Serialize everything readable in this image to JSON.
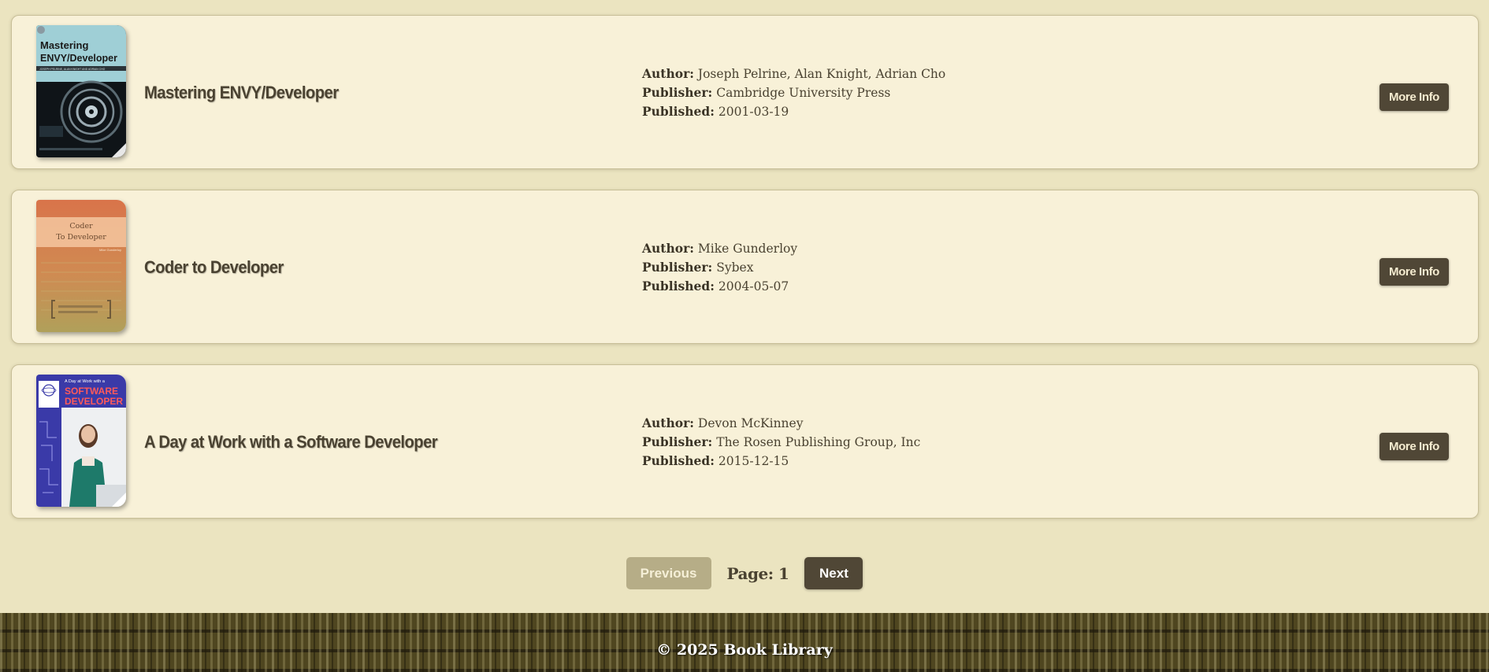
{
  "books": [
    {
      "title": "Mastering ENVY/Developer",
      "author_label": "Author:",
      "author": "Joseph Pelrine, Alan Knight, Adrian Cho",
      "publisher_label": "Publisher:",
      "publisher": "Cambridge University Press",
      "published_label": "Published:",
      "published": "2001-03-19",
      "button": "More Info",
      "cover": {
        "title_line1": "Mastering",
        "title_line2": "ENVY/Developer",
        "authors": "JOSEPH PELRINE, ALAN KNIGHT AND ADRIAN CHO"
      }
    },
    {
      "title": "Coder to Developer",
      "author_label": "Author:",
      "author": "Mike Gunderloy",
      "publisher_label": "Publisher:",
      "publisher": "Sybex",
      "published_label": "Published:",
      "published": "2004-05-07",
      "button": "More Info",
      "cover": {
        "title_line1": "Coder",
        "title_line2": "To Developer",
        "authors": "Mike Gunderloy"
      }
    },
    {
      "title": "A Day at Work with a Software Developer",
      "author_label": "Author:",
      "author": "Devon McKinney",
      "publisher_label": "Publisher:",
      "publisher": "The Rosen Publishing Group, Inc",
      "published_label": "Published:",
      "published": "2015-12-15",
      "button": "More Info",
      "cover": {
        "title_line1": "A Day at Work with a",
        "title_line2": "SOFTWARE",
        "title_line3": "DEVELOPER"
      }
    }
  ],
  "pagination": {
    "previous": "Previous",
    "page_label": "Page: 1",
    "next": "Next"
  },
  "footer": {
    "text": "© 2025 Book Library"
  },
  "colors": {
    "background": "#ebe4c0",
    "card": "#f8f1d8",
    "button_dark": "#504736",
    "button_disabled": "#b6ad87"
  }
}
